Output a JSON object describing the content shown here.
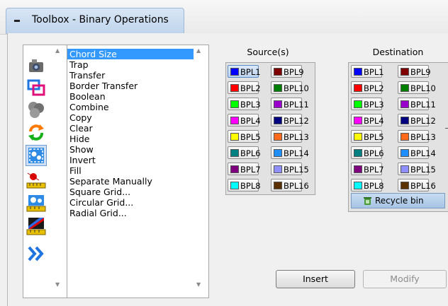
{
  "window": {
    "title": "Toolbox - Binary Operations"
  },
  "tools": [
    {
      "icon": "camera-icon"
    },
    {
      "icon": "overlap-frames-icon"
    },
    {
      "icon": "grey-blobs-icon"
    },
    {
      "icon": "swap-arrows-icon"
    },
    {
      "icon": "binary-operations-icon"
    },
    {
      "icon": "red-dot-ruler-icon"
    },
    {
      "icon": "blue-blobs-ruler-icon"
    },
    {
      "icon": "slash-ruler-icon"
    },
    {
      "icon": "double-chevron-icon"
    }
  ],
  "operations": [
    "Chord Size",
    "Trap",
    "Transfer",
    "Border Transfer",
    "Boolean",
    "Combine",
    "Copy",
    "Clear",
    "Hide",
    "Show",
    "Invert",
    "Fill",
    "Separate Manually",
    "Square Grid...",
    "Circular Grid...",
    "Radial Grid..."
  ],
  "selected_operation": "Chord Size",
  "source": {
    "label": "Source(s)",
    "planes": [
      {
        "label": "BPL1",
        "color": "#0000ff"
      },
      {
        "label": "BPL9",
        "color": "#7f0000"
      },
      {
        "label": "BPL2",
        "color": "#ff0000"
      },
      {
        "label": "BPL10",
        "color": "#007f00"
      },
      {
        "label": "BPL3",
        "color": "#00ff00"
      },
      {
        "label": "BPL11",
        "color": "#9900cc"
      },
      {
        "label": "BPL4",
        "color": "#ff00ff"
      },
      {
        "label": "BPL12",
        "color": "#000080"
      },
      {
        "label": "BPL5",
        "color": "#ffff00"
      },
      {
        "label": "BPL13",
        "color": "#ff6a1a"
      },
      {
        "label": "BPL6",
        "color": "#008080"
      },
      {
        "label": "BPL14",
        "color": "#1f8fff"
      },
      {
        "label": "BPL7",
        "color": "#7f007f"
      },
      {
        "label": "BPL15",
        "color": "#8f8fff"
      },
      {
        "label": "BPL8",
        "color": "#00ffff"
      },
      {
        "label": "BPL16",
        "color": "#5a3000"
      }
    ]
  },
  "destination": {
    "label": "Destination",
    "recycle_label": "Recycle bin"
  },
  "buttons": {
    "insert": "Insert",
    "modify": "Modify"
  }
}
